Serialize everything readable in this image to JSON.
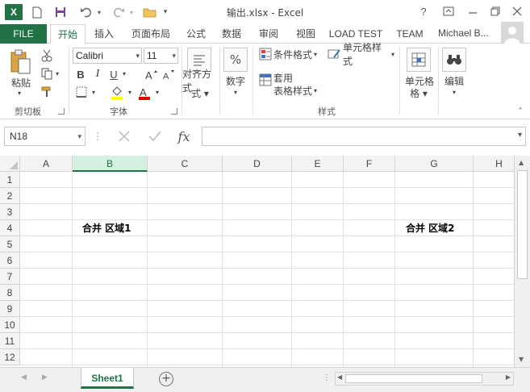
{
  "window": {
    "title": "输出.xlsx - Excel",
    "app_icon": "X",
    "help": "?"
  },
  "ribbon_tabs": [
    "FILE",
    "开始",
    "插入",
    "页面布局",
    "公式",
    "数据",
    "审阅",
    "视图",
    "LOAD TEST",
    "TEAM"
  ],
  "user": "Michael B...",
  "ribbon": {
    "paste_label": "粘贴",
    "clipboard_group": "剪切板",
    "font_name": "Calibri",
    "font_size": "11",
    "bold": "B",
    "italic": "I",
    "underline": "U",
    "font_group": "字体",
    "align_label": "对齐方式",
    "number_label": "数字",
    "cond_format": "条件格式",
    "cell_style": "单元格样式",
    "table_format_1": "套用",
    "table_format_2": "表格样式",
    "styles_group": "样式",
    "cells_label": "单元格",
    "edit_label": "编辑"
  },
  "formula_bar": {
    "name_box": "N18",
    "fx": "fx"
  },
  "grid": {
    "columns": [
      "A",
      "B",
      "C",
      "D",
      "E",
      "F",
      "G",
      "H"
    ],
    "selected_column": "B",
    "rows": [
      "1",
      "2",
      "3",
      "4",
      "5",
      "6",
      "7",
      "8",
      "9",
      "10",
      "11",
      "12"
    ],
    "merge_region_1": "合并 区域1",
    "merge_region_2": "合并 区域2"
  },
  "sheets": {
    "active": "Sheet1",
    "add": "+"
  },
  "colors": {
    "excel_green": "#217346",
    "selected_header": "#d3f0e0"
  }
}
